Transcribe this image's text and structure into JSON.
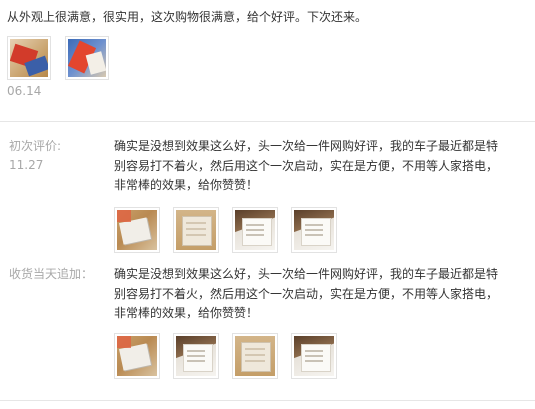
{
  "first_review": {
    "text": "从外观上很满意，很实用，这次购物很满意，给个好评。下次还来。",
    "date": "06.14",
    "photos": [
      {
        "icon": "review-photo-red-package"
      },
      {
        "icon": "review-photo-blue-package"
      }
    ]
  },
  "followup_review": {
    "label": "初次评价:",
    "date": "11.27",
    "text": "确实是没想到效果这么好，头一次给一件网购好评，我的车子最近都是特别容易打不着火，然后用这个一次启动，实在是方便，不用等人家搭电，非常棒的效果，给你赞赞！",
    "photos": [
      {
        "icon": "review-photo-box"
      },
      {
        "icon": "review-photo-tan"
      },
      {
        "icon": "review-photo-paper"
      },
      {
        "icon": "review-photo-paper"
      }
    ]
  },
  "append_review": {
    "label": "收货当天追加：",
    "text": "确实是没想到效果这么好，头一次给一件网购好评，我的车子最近都是特别容易打不着火，然后用这个一次启动，实在是方便，不用等人家搭电，非常棒的效果，给你赞赞！",
    "photos": [
      {
        "icon": "review-photo-box"
      },
      {
        "icon": "review-photo-paper"
      },
      {
        "icon": "review-photo-tan"
      },
      {
        "icon": "review-photo-paper"
      }
    ]
  }
}
